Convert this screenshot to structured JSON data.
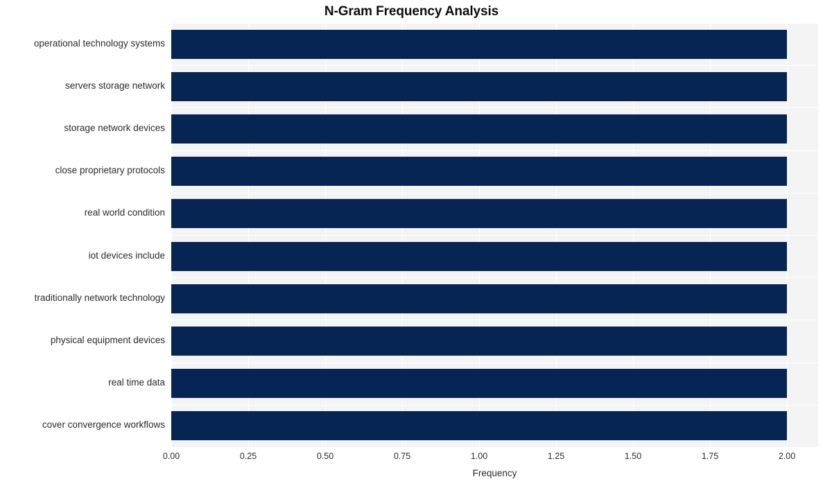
{
  "chart_data": {
    "type": "bar",
    "orientation": "horizontal",
    "title": "N-Gram Frequency Analysis",
    "xlabel": "Frequency",
    "ylabel": "",
    "categories": [
      "operational technology systems",
      "servers storage network",
      "storage network devices",
      "close proprietary protocols",
      "real world condition",
      "iot devices include",
      "traditionally network technology",
      "physical equipment devices",
      "real time data",
      "cover convergence workflows"
    ],
    "values": [
      2,
      2,
      2,
      2,
      2,
      2,
      2,
      2,
      2,
      2
    ],
    "xlim": [
      0,
      2.0
    ],
    "xticks": [
      "0.00",
      "0.25",
      "0.50",
      "0.75",
      "1.00",
      "1.25",
      "1.50",
      "1.75",
      "2.00"
    ],
    "xtick_values": [
      0,
      0.25,
      0.5,
      0.75,
      1.0,
      1.25,
      1.5,
      1.75,
      2.0
    ],
    "grid": true,
    "legend": false,
    "bar_color": "#072552",
    "plot_background": "#f4f4f5",
    "figure_background": "#ffffff",
    "gridline_color": "#ffffff"
  }
}
